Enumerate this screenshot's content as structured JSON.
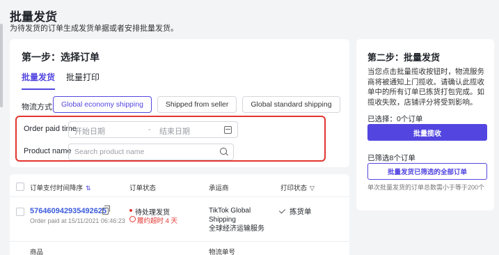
{
  "header": {
    "title": "批量发货",
    "subtitle": "为待发货的订单生成发货单据或者安排批量发货。"
  },
  "step1": {
    "title": "第一步：选择订单",
    "tabs": [
      {
        "label": "批量发货",
        "active": true
      },
      {
        "label": "批量打印",
        "active": false
      }
    ],
    "shipping_method_label": "物流方式",
    "shipping_options": [
      {
        "label": "Global economy shipping",
        "active": true
      },
      {
        "label": "Shipped from seller",
        "active": false
      },
      {
        "label": "Global standard shipping",
        "active": false
      }
    ],
    "order_paid_time_label": "Order paid time",
    "start_date_placeholder": "开始日期",
    "date_separator": "-",
    "end_date_placeholder": "结束日期",
    "product_name_label": "Product name",
    "product_search_placeholder": "Search product name"
  },
  "step2": {
    "title": "第二步：批量发货",
    "description": "当您点击批量揽收按钮时，物流服务商将被通知上门揽收。请确认此揽收单中的所有订单已拣货打包完成。如揽收失败，店铺评分将受到影响。",
    "selected_count": "已选择：0个订单",
    "bulk_pickup_label": "批量揽收",
    "filtered_count": "已筛选8个订单",
    "bulk_ship_all_label": "批量发货已筛选的全部订单",
    "max_note": "单次批量发货的订单总数需小于等于200个"
  },
  "table": {
    "headers": {
      "paid_time": "订单支付时间降序",
      "status": "订单状态",
      "carrier": "承运商",
      "print_status": "打印状态"
    },
    "rows": [
      {
        "order_id": "576460942935492625",
        "paid_at": "Order paid at 15/11/2021 06:46:23",
        "status": "待处理发货",
        "deadline": "履约超时 4 天",
        "carrier_line1": "TikTok Global",
        "carrier_line2": "Shipping",
        "carrier_line3": "全球经济运输服务",
        "print_status": "拣货单"
      }
    ],
    "sub_headers": {
      "goods": "商品",
      "tracking": "物流单号"
    }
  },
  "colors": {
    "accent": "#5346e0",
    "highlight_border": "#e3342f",
    "danger": "#e3342f",
    "link": "#3b5bdb"
  }
}
